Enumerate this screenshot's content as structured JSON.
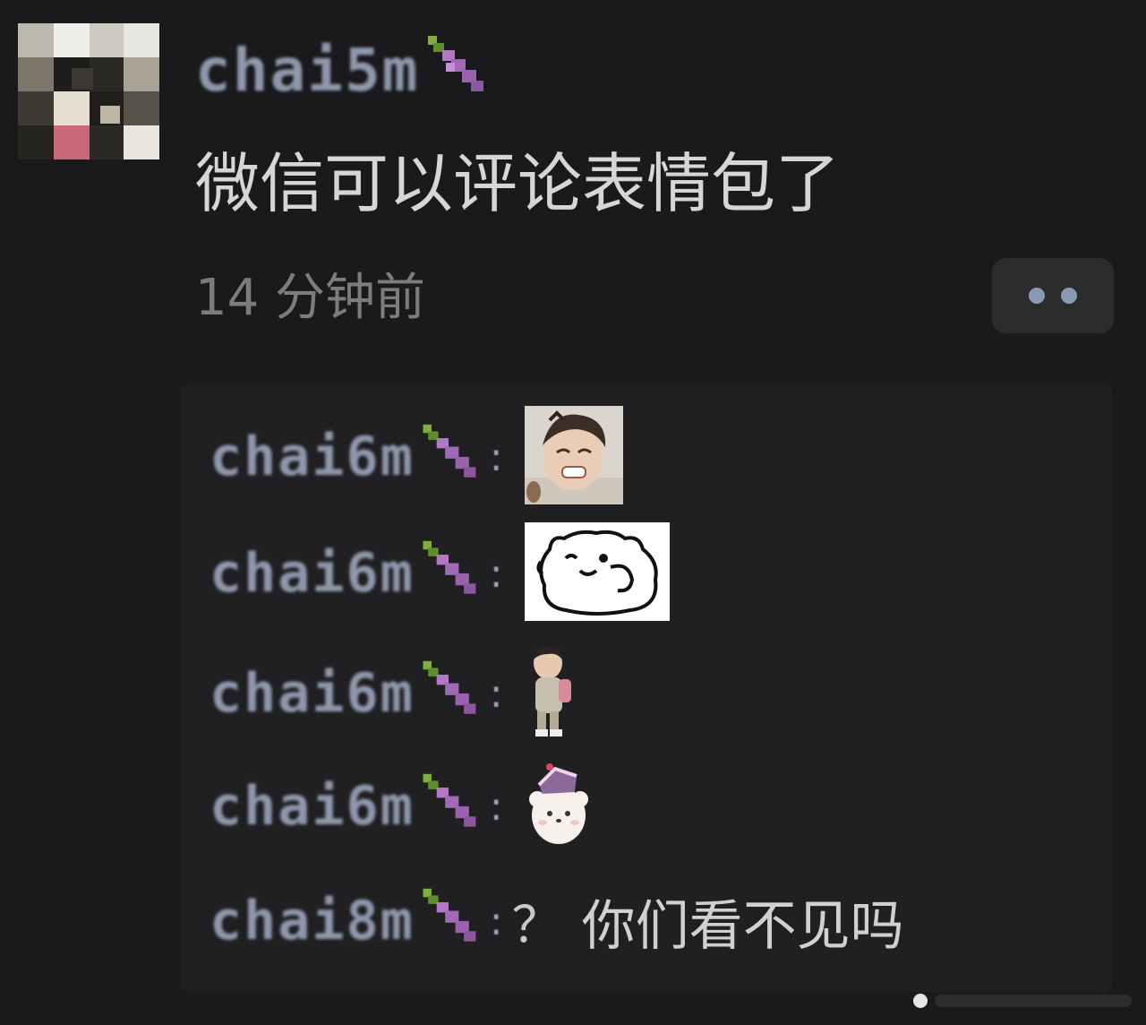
{
  "post": {
    "author": {
      "name": "chai5m",
      "emoji": "eggplant-icon",
      "avatar": "pixelated-avatar"
    },
    "text": "微信可以评论表情包了",
    "time": "14 分钟前",
    "more_button": "more-dots-icon"
  },
  "comments": [
    {
      "author": "chai6m",
      "emoji": "eggplant-icon",
      "sticker": "crying-child-photo-sticker"
    },
    {
      "author": "chai6m",
      "emoji": "eggplant-icon",
      "sticker": "white-cat-meme-sticker"
    },
    {
      "author": "chai6m",
      "emoji": "eggplant-icon",
      "sticker": "walking-toddler-sticker"
    },
    {
      "author": "chai6m",
      "emoji": "eggplant-icon",
      "sticker": "bear-with-cake-sticker"
    },
    {
      "author": "chai8m",
      "emoji": "eggplant-icon",
      "text": "你们看不见吗",
      "prefix": "？"
    }
  ],
  "colors": {
    "background": "#1a1a1c",
    "panel": "#202022",
    "name": "#8e98ad",
    "text": "#d6d6d6",
    "time": "#7c7c7c"
  }
}
